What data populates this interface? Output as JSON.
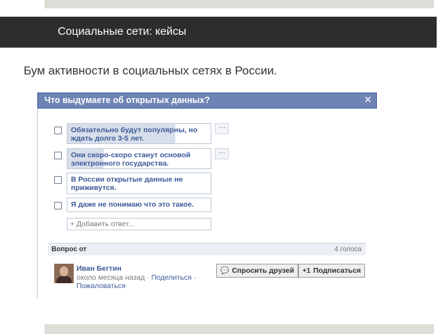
{
  "slide": {
    "header_title": "Социальные сети: кейсы",
    "subtitle": "Бум активности в социальных сетях в России."
  },
  "poll": {
    "question": "Что выдумаете об открытых данных?",
    "close_glyph": "✕",
    "options": [
      {
        "text": "Обязательно будут популярны, но ждать долго 3-5 лет.",
        "vote_share": 0.75,
        "more": "···"
      },
      {
        "text": "Они скоро-скоро станут основой электронного государства.",
        "vote_share": 0.25,
        "more": "···"
      },
      {
        "text": "В России открытые данные не приживутся.",
        "vote_share": 0
      },
      {
        "text": "Я даже не понимаю что это такое.",
        "vote_share": 0
      }
    ],
    "add_answer_placeholder": "+ Добавить ответ...",
    "asked_by_label": "Вопрос от",
    "votes": "4 голоса",
    "author": {
      "name": "Иван Бегтин",
      "time": "около месяца назад",
      "separator1": "·",
      "share": "Поделиться",
      "separator2": "·",
      "report": "Пожаловаться"
    },
    "buttons": {
      "ask_friends": "Спросить друзей",
      "ask_friends_icon": "💬",
      "subscribe": "Подписаться",
      "subscribe_icon": "+1"
    }
  }
}
